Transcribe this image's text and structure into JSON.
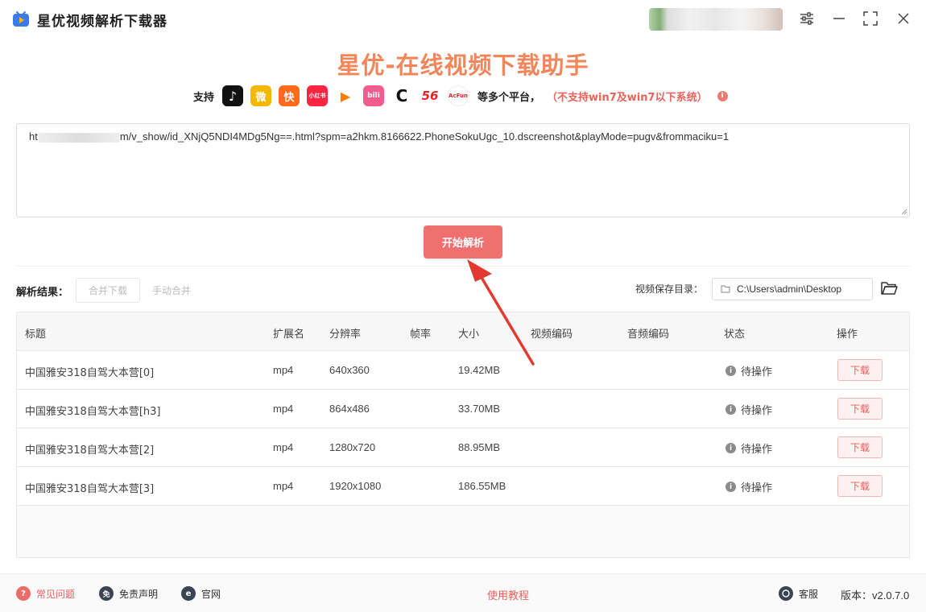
{
  "window": {
    "title": "星优视频解析下载器",
    "icons": [
      "app-logo",
      "settings-sliders-icon",
      "minimize-icon",
      "maximize-icon",
      "close-icon"
    ]
  },
  "header": {
    "hero_title": "星优-在线视频下载助手",
    "support_label": "支持",
    "platforms": [
      {
        "name": "douyin",
        "glyph": "♪",
        "bg": "#111111"
      },
      {
        "name": "weibo",
        "glyph": "微",
        "bg": "#f5b800"
      },
      {
        "name": "kuaishou",
        "glyph": "快",
        "bg": "#ff6a1a"
      },
      {
        "name": "xiaohongshu",
        "glyph": "小红书",
        "bg": "#ff2442"
      },
      {
        "name": "tencent-video",
        "glyph": "▶",
        "bg": "#ffffff"
      },
      {
        "name": "bilibili",
        "glyph": "bili",
        "bg": "#f25d8e"
      },
      {
        "name": "cctv",
        "glyph": "C",
        "bg": "#ffffff"
      },
      {
        "name": "56",
        "glyph": "56",
        "bg": "#ffffff"
      },
      {
        "name": "acfun",
        "glyph": "AcFun",
        "bg": "#ffffff"
      }
    ],
    "more_text": "等多个平台，",
    "warning_text": "（不支持win7及win7以下系统）",
    "info_glyph": "i"
  },
  "url_input": {
    "prefix": "ht",
    "suffix": "m/v_show/id_XNjQ5NDI4MDg5Ng==.html?spm=a2hkm.8166622.PhoneSokuUgc_10.dscreenshot&playMode=pugv&frommaciku=1"
  },
  "parse_button": "开始解析",
  "toolbar": {
    "result_label": "解析结果：",
    "merge_download": "合并下载",
    "manual_merge": "手动合并",
    "save_dir_label": "视频保存目录：",
    "save_dir_value": "C:\\Users\\admin\\Desktop"
  },
  "table": {
    "columns": [
      "标题",
      "扩展名",
      "分辨率",
      "帧率",
      "大小",
      "视频编码",
      "音频编码",
      "状态",
      "操作"
    ],
    "rows": [
      {
        "title": "中国雅安318自驾大本营[0]",
        "ext": "mp4",
        "resolution": "640x360",
        "fps": "",
        "size": "19.42MB",
        "vcodec": "",
        "acodec": "",
        "status": "待操作",
        "action": "下载"
      },
      {
        "title": "中国雅安318自驾大本营[h3]",
        "ext": "mp4",
        "resolution": "864x486",
        "fps": "",
        "size": "33.70MB",
        "vcodec": "",
        "acodec": "",
        "status": "待操作",
        "action": "下载"
      },
      {
        "title": "中国雅安318自驾大本营[2]",
        "ext": "mp4",
        "resolution": "1280x720",
        "fps": "",
        "size": "88.95MB",
        "vcodec": "",
        "acodec": "",
        "status": "待操作",
        "action": "下载"
      },
      {
        "title": "中国雅安318自驾大本营[3]",
        "ext": "mp4",
        "resolution": "1920x1080",
        "fps": "",
        "size": "186.55MB",
        "vcodec": "",
        "acodec": "",
        "status": "待操作",
        "action": "下载"
      }
    ]
  },
  "footer": {
    "faq": "常见问题",
    "disclaimer": "免责声明",
    "website": "官网",
    "tutorial": "使用教程",
    "support": "客服",
    "version": "版本：v2.0.7.0"
  },
  "colors": {
    "accent": "#f07070",
    "hero": "#f0865a",
    "warning": "#e8635a"
  }
}
